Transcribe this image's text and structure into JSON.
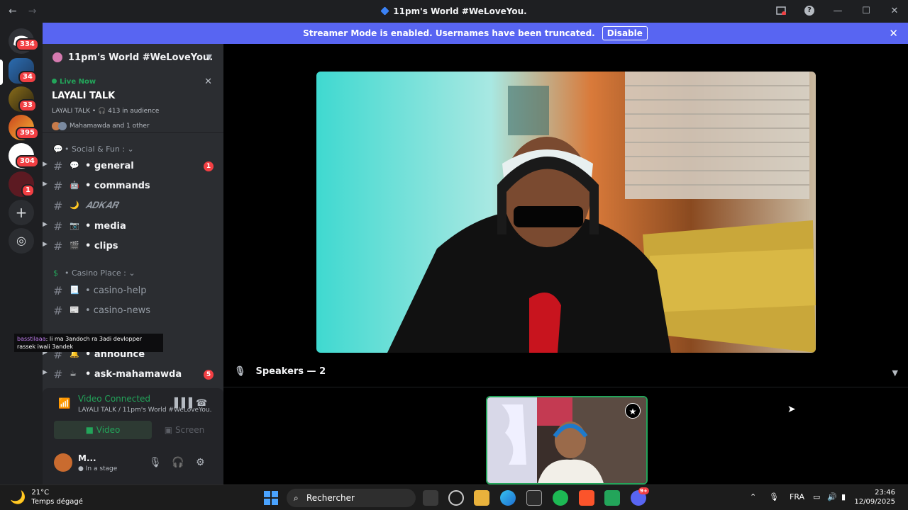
{
  "window": {
    "title": "11pm's World #WeLoveYou.",
    "back_icon": "←",
    "forward_icon": "→"
  },
  "banner": {
    "message": "Streamer Mode is enabled. Usernames have been truncated.",
    "button": "Disable"
  },
  "servers": {
    "badges": [
      "334",
      "34",
      "33",
      "395",
      "304",
      "1"
    ]
  },
  "server_header": {
    "name": "11pm's World #WeLoveYou."
  },
  "live": {
    "label": "Live Now",
    "stage_name": "LAYALI TALK",
    "meta": "LAYALI TALK • 🎧 413 in audience",
    "users": "Mahamawda and 1 other"
  },
  "categories": {
    "social": "Social & Fun :",
    "casino": "Casino Place :"
  },
  "channels": [
    {
      "emoji": "💬",
      "name": "• general",
      "count": "1"
    },
    {
      "emoji": "🤖",
      "name": "• commands"
    },
    {
      "emoji": "🌙",
      "name": "𝑨𝑫𝑲𝑨𝑹"
    },
    {
      "emoji": "📷",
      "name": "• media"
    },
    {
      "emoji": "🎬",
      "name": "• clips"
    },
    {
      "emoji": "📃",
      "name": "• casino-help"
    },
    {
      "emoji": "📰",
      "name": "• casino-news"
    },
    {
      "emoji": "🔔",
      "name": "• announce"
    },
    {
      "emoji": "☕",
      "name": "• ask-mahamawda",
      "count": "5"
    }
  ],
  "chat_overlay": {
    "user": "basstilaaa",
    "text": ": li ma 3andoch ra 3adi devlopper rassek iwali 3andek"
  },
  "voice": {
    "status": "Video Connected",
    "location": "LAYALI TALK / 11pm's World #WeLoveYou.",
    "video_btn": "Video",
    "screen_btn": "Screen"
  },
  "user": {
    "name": "M...",
    "status": "In a stage"
  },
  "stage": {
    "speakers_label": "Speakers — 2"
  },
  "taskbar": {
    "temp": "21°C",
    "weather": "Temps dégagé",
    "search": "Rechercher",
    "lang": "FRA",
    "time": "23:46",
    "date": "12/09/2025",
    "discord_badge": "9+"
  }
}
